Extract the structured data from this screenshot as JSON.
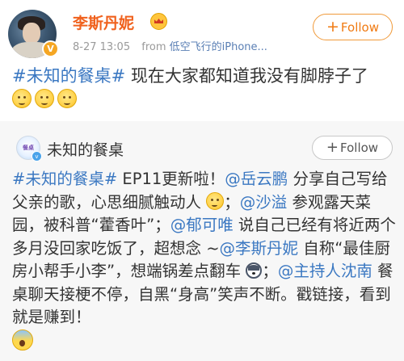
{
  "post": {
    "username": "李斯丹妮",
    "timestamp": "8-27 13:05",
    "source_prefix": "from",
    "source_device": "低空飞行的iPhone...",
    "follow_label": "Follow",
    "text_hashtag": "#未知的餐桌#",
    "text_body": " 现在大家都知道我没有脚脖子了",
    "emojis": [
      "smiley-icon",
      "smiley-icon",
      "smiley-icon"
    ]
  },
  "repost": {
    "username": "未知的餐桌",
    "avatar_text": "未知的餐桌",
    "follow_label": "Follow",
    "segments": {
      "s1": "#未知的餐桌#",
      "s2": " EP11更新啦！",
      "s3": "@岳云鹏",
      "s4": " 分享自己写给父亲的歌，心思细腻触动人",
      "s5": "；",
      "s6": "@沙溢",
      "s7": " 参观露天菜园，被科普“藿香叶”；",
      "s8": "@郁可唯",
      "s9": " 说自己已经有将近两个多月没回家吃饭了，超想念 ~",
      "s10": "@李斯丹妮",
      "s11": " 自称“最佳厨房小帮手小李”，想端锅差点翻车",
      "s12": "；",
      "s13": "@主持人沈南",
      "s14": " 餐桌聊天接梗不停，自黑“身高”笑声不断。戳链接，看到就是赚到！"
    }
  },
  "colors": {
    "username": "#f0611d",
    "link": "#3b78c2",
    "follow_orange": "#f07a12",
    "repost_bg": "#f7f7f7"
  }
}
